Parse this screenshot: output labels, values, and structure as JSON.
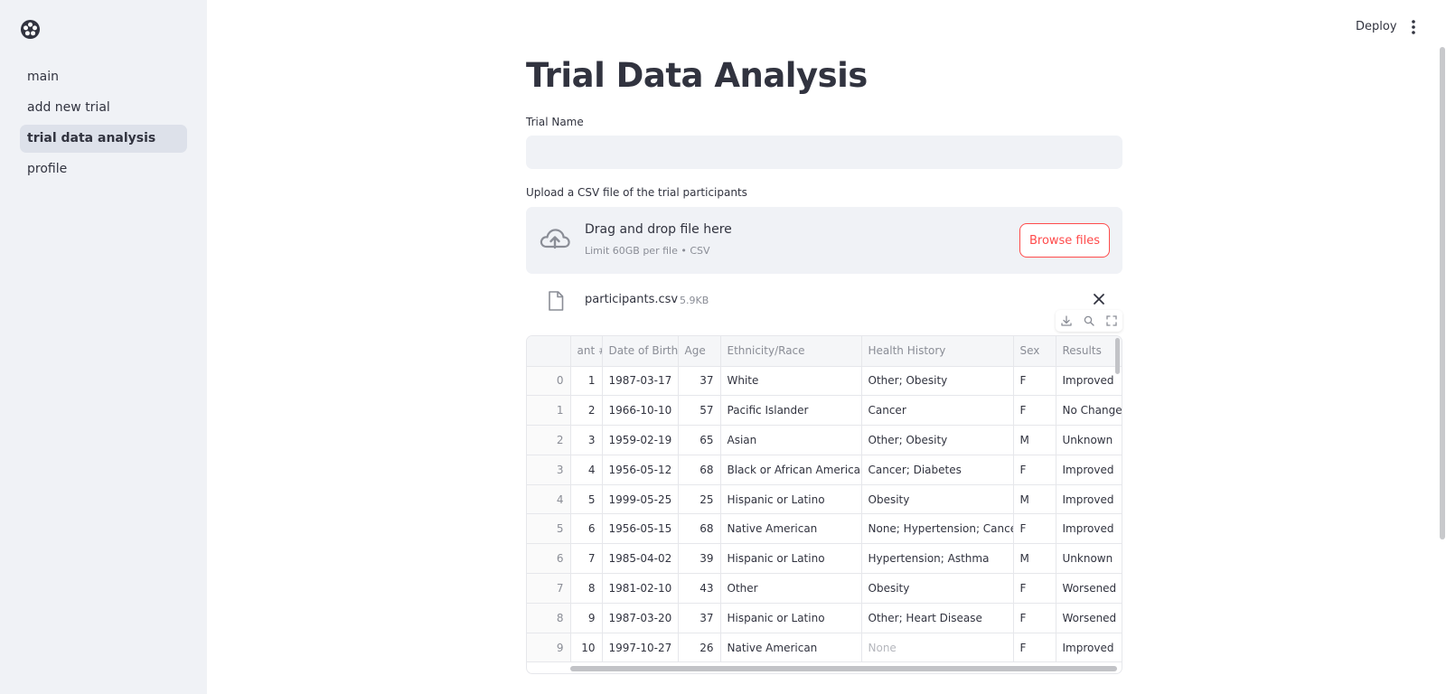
{
  "sidebar": {
    "items": [
      {
        "label": "main"
      },
      {
        "label": "add new trial"
      },
      {
        "label": "trial data analysis"
      },
      {
        "label": "profile"
      }
    ]
  },
  "header": {
    "deploy_label": "Deploy",
    "menu_icon": "vertical-dots-icon"
  },
  "page": {
    "title": "Trial Data Analysis",
    "trial_name_label": "Trial Name",
    "trial_name_value": "",
    "upload_label": "Upload a CSV file of the trial participants"
  },
  "uploader": {
    "title": "Drag and drop file here",
    "subtitle": "Limit 60GB per file • CSV",
    "browse_label": "Browse files",
    "icon": "cloud-upload-icon"
  },
  "file": {
    "name": "participants.csv",
    "size": "5.9KB",
    "icon": "file-icon"
  },
  "table": {
    "columns": [
      "",
      "ant #",
      "Date of Birth",
      "Age",
      "Ethnicity/Race",
      "Health History",
      "Sex",
      "Results"
    ],
    "rows": [
      [
        "0",
        "1",
        "1987-03-17",
        "37",
        "White",
        "Other; Obesity",
        "F",
        "Improved"
      ],
      [
        "1",
        "2",
        "1966-10-10",
        "57",
        "Pacific Islander",
        "Cancer",
        "F",
        "No Change"
      ],
      [
        "2",
        "3",
        "1959-02-19",
        "65",
        "Asian",
        "Other; Obesity",
        "M",
        "Unknown"
      ],
      [
        "3",
        "4",
        "1956-05-12",
        "68",
        "Black or African American",
        "Cancer; Diabetes",
        "F",
        "Improved"
      ],
      [
        "4",
        "5",
        "1999-05-25",
        "25",
        "Hispanic or Latino",
        "Obesity",
        "M",
        "Improved"
      ],
      [
        "5",
        "6",
        "1956-05-15",
        "68",
        "Native American",
        "None; Hypertension; Cancer",
        "F",
        "Improved"
      ],
      [
        "6",
        "7",
        "1985-04-02",
        "39",
        "Hispanic or Latino",
        "Hypertension; Asthma",
        "M",
        "Unknown"
      ],
      [
        "7",
        "8",
        "1981-02-10",
        "43",
        "Other",
        "Obesity",
        "F",
        "Worsened"
      ],
      [
        "8",
        "9",
        "1987-03-20",
        "37",
        "Hispanic or Latino",
        "Other; Heart Disease",
        "F",
        "Worsened"
      ],
      [
        "9",
        "10",
        "1997-10-27",
        "26",
        "Native American",
        "None",
        "F",
        "Improved"
      ]
    ]
  },
  "colors": {
    "accent": "#ff4b4b",
    "sidebar_bg": "#f0f2f6",
    "active_item_bg": "#dde1ea"
  }
}
